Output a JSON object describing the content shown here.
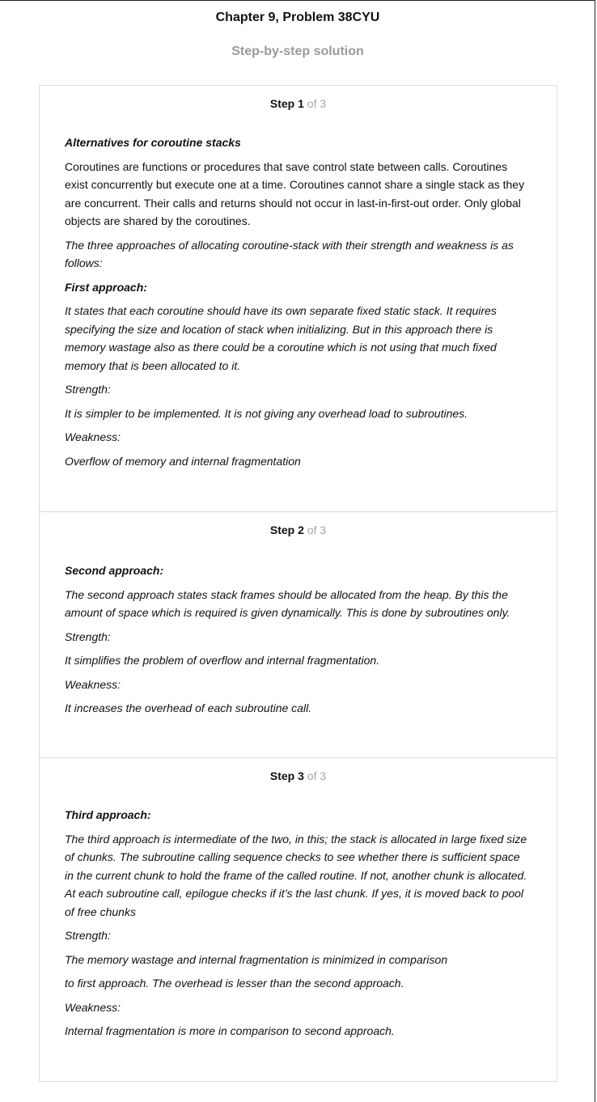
{
  "page": {
    "title": "Chapter 9, Problem 38CYU",
    "subtitle": "Step-by-step solution"
  },
  "steps": [
    {
      "step_word": "Step",
      "number": "1",
      "of_text": " of 3",
      "paragraphs": [
        "Alternatives for coroutine stacks",
        "Coroutines are functions or procedures that save control state between calls. Coroutines exist concurrently but execute one at a time. Coroutines cannot share a single stack as they are concurrent. Their calls and returns should not occur in last-in-first-out order. Only global objects are shared by the coroutines.",
        "The three approaches of allocating coroutine-stack with their strength and weakness is as follows:",
        "First approach:",
        "It states that each coroutine should have its own separate fixed static stack. It requires specifying the size and location of stack when initializing. But in this approach there is memory wastage also as there could be a coroutine which is not using that much fixed memory that is been allocated to it.",
        "Strength:",
        "It is simpler to be implemented. It is not giving any overhead load to subroutines.",
        "Weakness:",
        "Overflow of memory and internal fragmentation"
      ]
    },
    {
      "step_word": "Step",
      "number": "2",
      "of_text": " of 3",
      "paragraphs": [
        "Second approach:",
        "The second approach states stack frames should be allocated from the heap. By this the amount of space which is required is given dynamically. This is done by subroutines only.",
        "Strength:",
        "It simplifies the problem of overflow and internal fragmentation.",
        "Weakness:",
        "It increases the overhead of each subroutine call."
      ]
    },
    {
      "step_word": "Step",
      "number": "3",
      "of_text": " of 3",
      "paragraphs": [
        "Third approach:",
        "The third approach is intermediate of the two, in this; the stack is allocated in large fixed size of chunks. The subroutine calling sequence checks to see whether there is sufficient space in the current chunk to hold the frame of the called routine. If not, another chunk is allocated. At each subroutine call, epilogue checks if it’s the last chunk. If yes, it is moved back to pool of free chunks",
        "Strength:",
        "The memory wastage and internal fragmentation is minimized in comparison",
        "to first approach. The overhead is lesser than the second approach.",
        "Weakness:",
        "Internal fragmentation is more in comparison to second approach."
      ]
    }
  ]
}
